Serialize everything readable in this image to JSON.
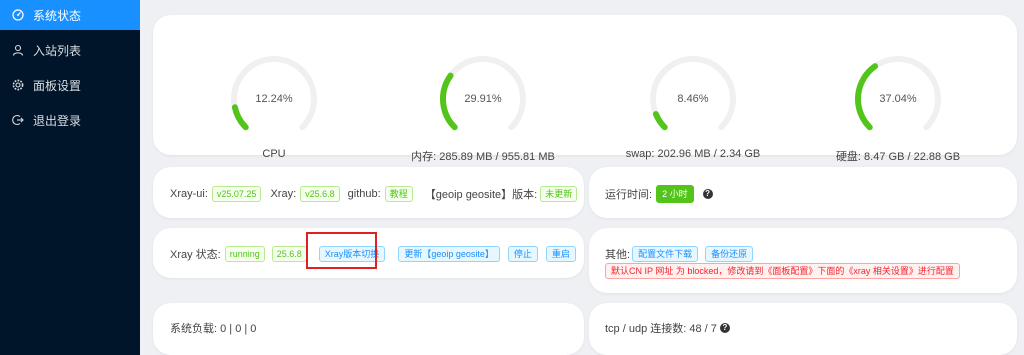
{
  "sidebar": {
    "items": [
      {
        "label": "系统状态",
        "icon": "dashboard-icon",
        "active": true
      },
      {
        "label": "入站列表",
        "icon": "user-icon",
        "active": false
      },
      {
        "label": "面板设置",
        "icon": "gear-icon",
        "active": false
      },
      {
        "label": "退出登录",
        "icon": "logout-icon",
        "active": false
      }
    ]
  },
  "gauges": [
    {
      "value": "12.24%",
      "percent": 12.24,
      "label": "CPU"
    },
    {
      "value": "29.91%",
      "percent": 29.91,
      "label": "内存: 285.89 MB / 955.81 MB"
    },
    {
      "value": "8.46%",
      "percent": 8.46,
      "label": "swap: 202.96 MB / 2.34 GB"
    },
    {
      "value": "37.04%",
      "percent": 37.04,
      "label": "硬盘: 8.47 GB / 22.88 GB"
    }
  ],
  "gauge_color": "#52c41a",
  "gauge_track_color": "#f0f0f0",
  "versions": {
    "xrayui_label": "Xray-ui:",
    "xrayui_version": "v25.07.25",
    "xray_label": "Xray:",
    "xray_version": "v25.6.8",
    "github_label": "github:",
    "github_tag": "教程",
    "geo_label": "【geoip geosite】版本:",
    "geo_status": "未更新"
  },
  "uptime": {
    "label": "运行时间:",
    "value": "2 小时"
  },
  "xray_status": {
    "label": "Xray 状态:",
    "state": "running",
    "version": "25.6.8",
    "switch_button": "Xray版本切换",
    "update_button": "更新【geoip geosite】",
    "stop_button": "停止",
    "restart_button": "重启"
  },
  "other": {
    "label": "其他:",
    "download_button": "配置文件下载",
    "backup_button": "备份还原",
    "warning": "默认CN IP 网址 为 blocked，修改请到《面板配置》下面的《xray 相关设置》进行配置"
  },
  "system_load": {
    "label": "系统负载: 0 | 0 | 0"
  },
  "connections": {
    "label": "tcp / udp 连接数: 48 / 7"
  }
}
